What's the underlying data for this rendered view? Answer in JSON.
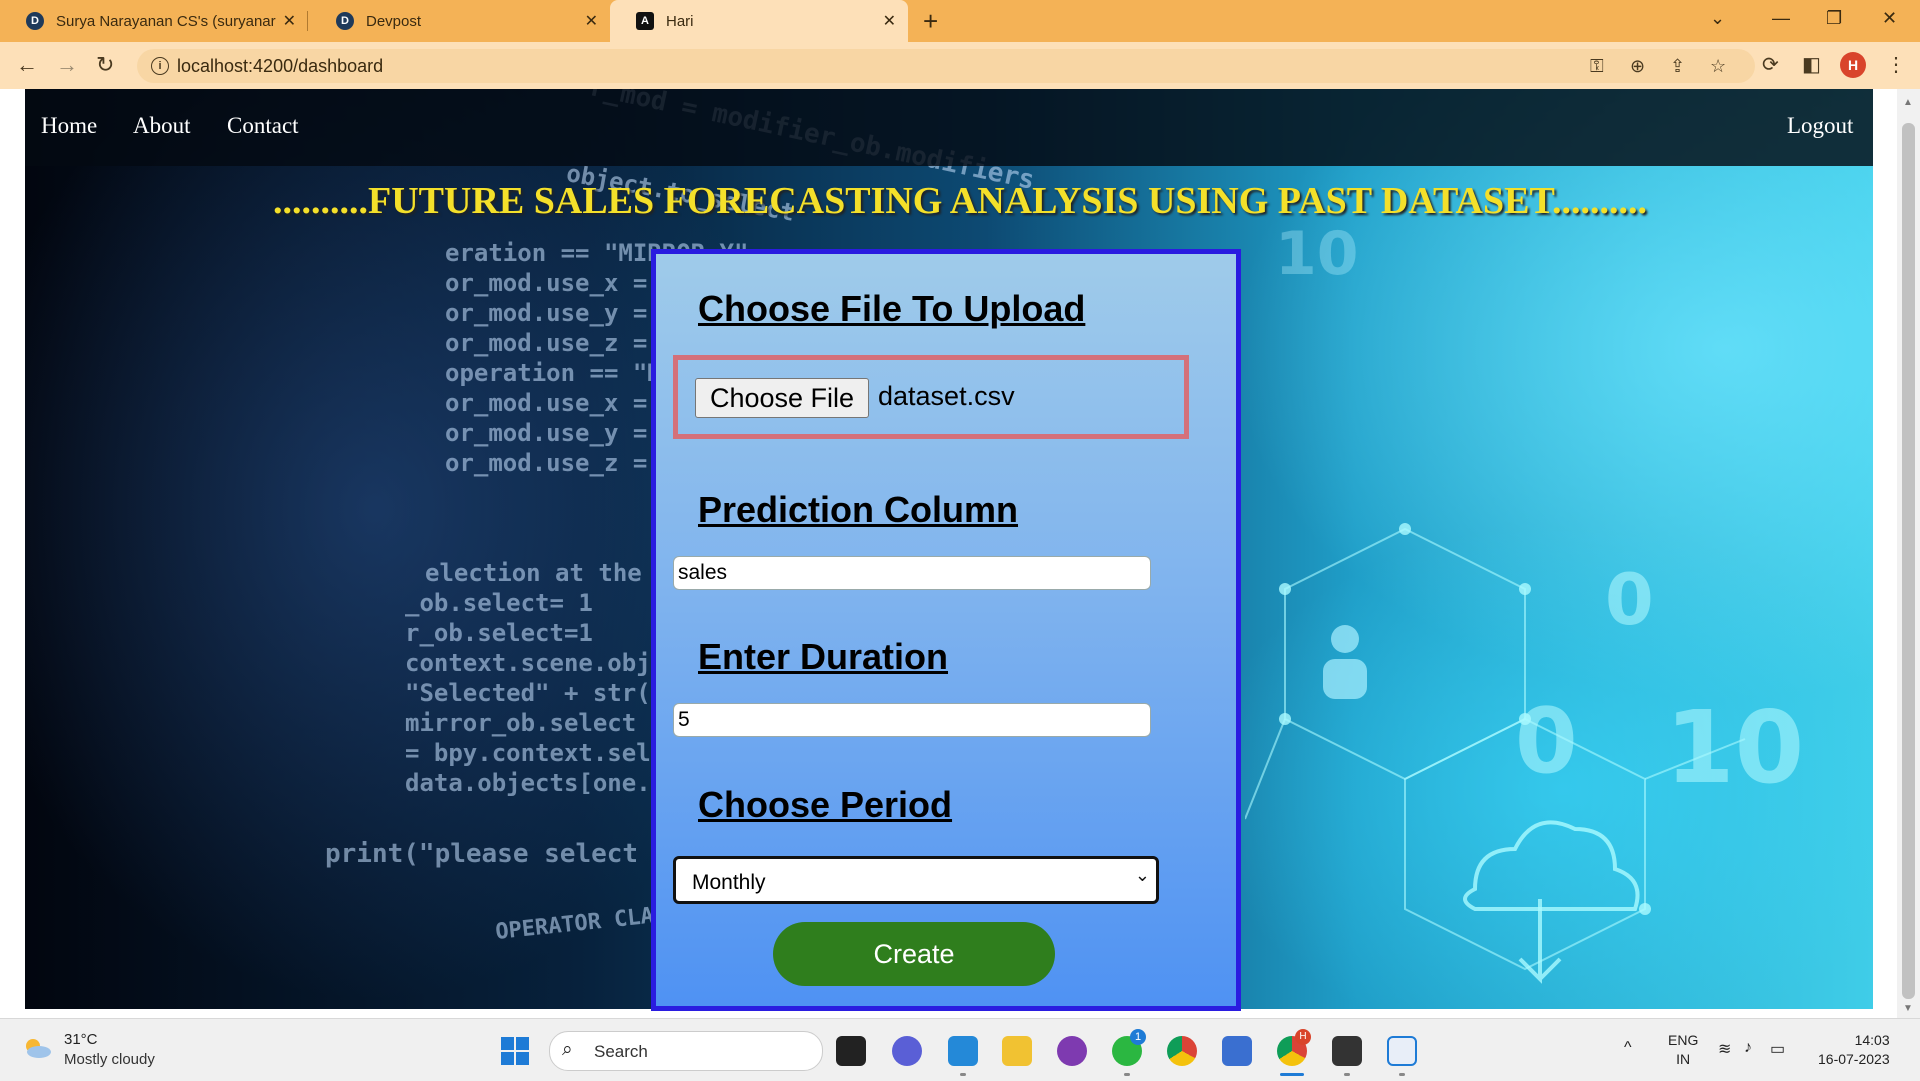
{
  "browser": {
    "tabs": [
      {
        "title": "Surya Narayanan CS's (suryanara",
        "favicon": "D"
      },
      {
        "title": "Devpost",
        "favicon": "D"
      },
      {
        "title": "Hari",
        "favicon": "A",
        "active": true
      }
    ],
    "new_tab_label": "+",
    "url": "localhost:4200/dashboard",
    "profile_initial": "H",
    "tabstrip_color": "#f4b256",
    "toolbar_color": "#fde0b8"
  },
  "nav": {
    "links": [
      "Home",
      "About",
      "Contact"
    ],
    "logout": "Logout"
  },
  "headline": "..........FUTURE SALES FORECASTING ANALYSIS USING PAST DATASET..........",
  "form": {
    "upload_heading": "Choose File To Upload",
    "choose_file_label": "Choose File",
    "file_name": "dataset.csv",
    "prediction_heading": "Prediction Column",
    "prediction_value": "sales",
    "duration_heading": "Enter Duration",
    "duration_value": "5",
    "period_heading": "Choose Period",
    "period_value": "Monthly",
    "create_label": "Create",
    "card_border_color": "#2a1ce0",
    "file_box_border_color": "#d4707a",
    "create_color": "#2f7e1d"
  },
  "taskbar": {
    "weather_temp": "31°C",
    "weather_desc": "Mostly cloudy",
    "search_label": "Search",
    "whatsapp_badge": "1",
    "chrome_badge": "H",
    "lang_top": "ENG",
    "lang_bottom": "IN",
    "time": "14:03",
    "date": "16-07-2023"
  }
}
